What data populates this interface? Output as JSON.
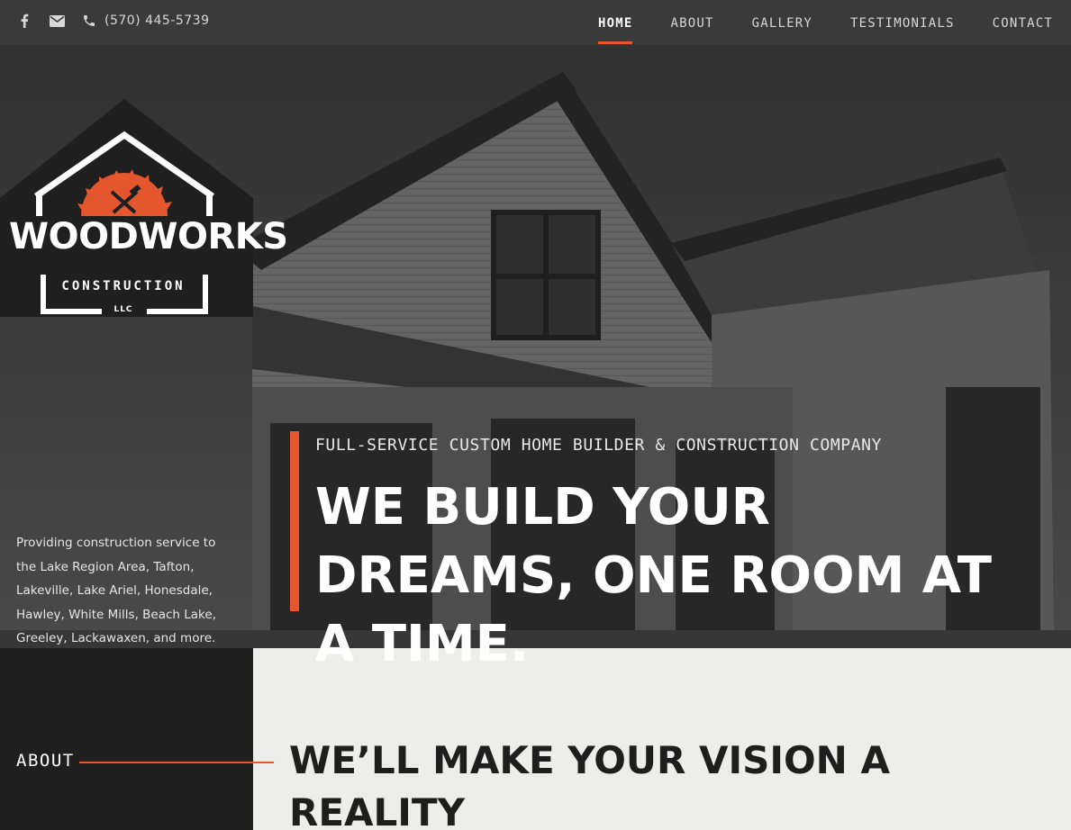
{
  "topbar": {
    "phone": "(570) 445-5739",
    "icons": [
      "facebook-icon",
      "email-icon",
      "phone-icon"
    ]
  },
  "nav": {
    "items": [
      {
        "label": "HOME",
        "active": true
      },
      {
        "label": "ABOUT",
        "active": false
      },
      {
        "label": "GALLERY",
        "active": false
      },
      {
        "label": "TESTIMONIALS",
        "active": false
      },
      {
        "label": "CONTACT",
        "active": false
      }
    ]
  },
  "logo": {
    "name": "WOODWORKS",
    "subtitle": "CONSTRUCTION",
    "suffix": "LLC"
  },
  "sidebar": {
    "description": "Providing construction service to the Lake Region Area, Tafton, Lakeville, Lake Ariel, Honesdale, Hawley, White Mills, Beach Lake, Greeley, Lackawaxen, and more.",
    "about_label": "ABOUT"
  },
  "hero": {
    "tagline": "FULL-SERVICE CUSTOM HOME BUILDER & CONSTRUCTION COMPANY",
    "headline": "WE BUILD YOUR DREAMS, ONE ROOM AT A TIME."
  },
  "section": {
    "title": "WE’LL MAKE YOUR VISION A REALITY"
  },
  "colors": {
    "accent": "#e4572e",
    "sidebar_bg": "#1f1f1f",
    "topbar_bg": "#3a3a3a",
    "section_bg": "#ededeb"
  }
}
